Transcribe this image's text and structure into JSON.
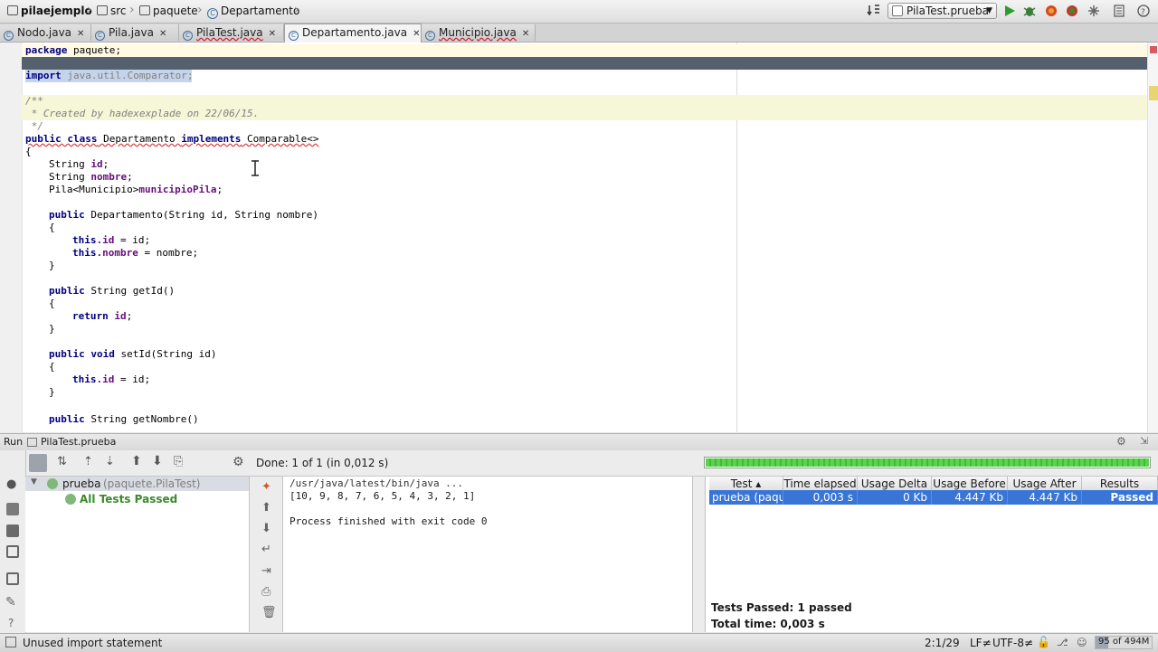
{
  "breadcrumb": {
    "project": "pilaejemplo",
    "src": "src",
    "package": "paquete",
    "class": "Departamento"
  },
  "toolbar": {
    "run_config": "PilaTest.prueba"
  },
  "tabs": [
    {
      "label": "Nodo.java"
    },
    {
      "label": "Pila.java"
    },
    {
      "label": "PilaTest.java"
    },
    {
      "label": "Departamento.java"
    },
    {
      "label": "Municipio.java"
    }
  ],
  "code": {
    "l1_kw": "package",
    "l1_rest": " paquete;",
    "l3_kw": "import",
    "l3_rest": " java.util.Comparator;",
    "l5": "/**",
    "l6": " * Created by hadexexplade on 22/06/15.",
    "l7": " */",
    "l8_kw": "public class",
    "l8_name": " Departamento ",
    "l8_impl": "implements",
    "l8_rest": " Comparable<>",
    "l9": "{",
    "l10_type": "String ",
    "l10_f": "id",
    "l11_type": "String ",
    "l11_f": "nombre",
    "l12_type": "Pila<Municipio>",
    "l12_f": "municipioPila",
    "l14_kw": "public",
    "l14_rest": " Departamento(String id, String nombre)",
    "l15": "{",
    "l16_kw": "this",
    "l16_f": ".id",
    "l16_rest": " = id;",
    "l17_kw": "this",
    "l17_f": ".nombre",
    "l17_rest": " = nombre;",
    "l18": "}",
    "l20_kw": "public",
    "l20_rest": " String getId()",
    "l21": "{",
    "l22_kw": "return",
    "l22_f": " id",
    "l23": "}",
    "l25_kw": "public void",
    "l25_rest": " setId(String id)",
    "l26": "{",
    "l27_kw": "this",
    "l27_f": ".id",
    "l27_rest": " = id;",
    "l28": "}",
    "l30_kw": "public",
    "l30_rest": " String getNombre()",
    "semi": ";"
  },
  "run_panel": {
    "label": "Run",
    "config": "PilaTest.prueba",
    "status": "Done: 1 of 1 (in 0,012 s)",
    "progress": 1.0,
    "tree_root": "prueba",
    "tree_root_detail": "(paquete.PilaTest)",
    "tree_child": "All Tests Passed",
    "console": {
      "cmd": "/usr/java/latest/bin/java ...",
      "output": "[10, 9, 8, 7, 6, 5, 4, 3, 2, 1]",
      "exit": "Process finished with exit code 0"
    },
    "table": {
      "headers": [
        "Test ▴",
        "Time elapsed",
        "Usage Delta",
        "Usage Before",
        "Usage After",
        "Results"
      ],
      "row": [
        "prueba (paque",
        "0,003 s",
        "0 Kb",
        "4.447 Kb",
        "4.447 Kb",
        "Passed"
      ]
    },
    "summary_passed": "Tests Passed: 1 passed",
    "summary_time": "Total time: 0,003 s"
  },
  "statusbar": {
    "message": "Unused import statement",
    "position": "2:1/29",
    "line_sep": "LF≠",
    "encoding": "UTF-8≠",
    "memory": "95 of 494M"
  },
  "colors": {
    "selection": "#3875d7",
    "progress": "#5bd34c",
    "passed": "#3a8a2a"
  }
}
